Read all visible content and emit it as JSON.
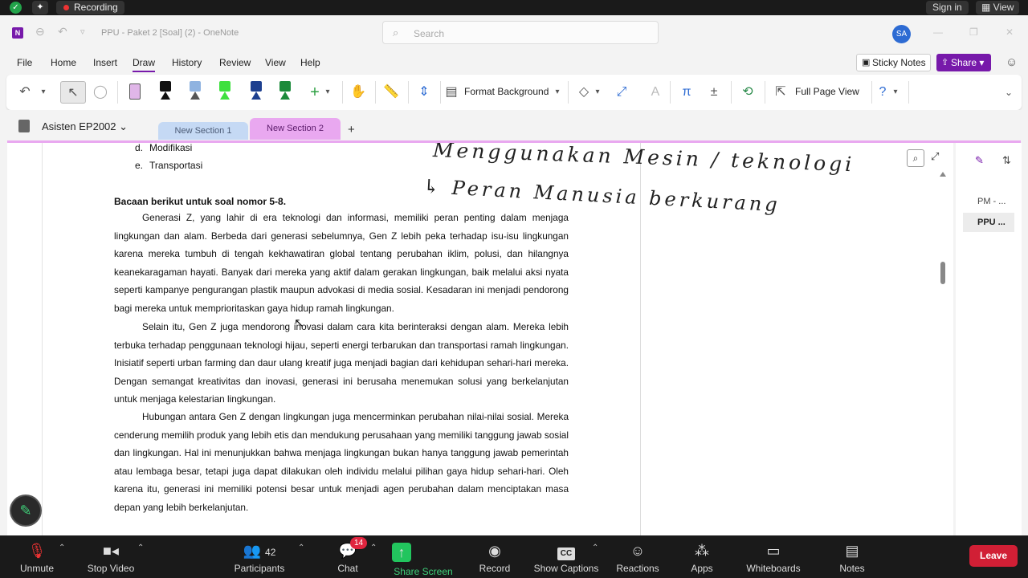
{
  "zoom_top": {
    "recording_label": "Recording",
    "signin_label": "Sign in",
    "view_label": "View"
  },
  "titlebar": {
    "title": "PPU - Paket 2 [Soal] (2)  -  OneNote",
    "search_placeholder": "Search",
    "avatar_initials": "SA"
  },
  "menu": {
    "file": "File",
    "home": "Home",
    "insert": "Insert",
    "draw": "Draw",
    "history": "History",
    "review": "Review",
    "view": "View",
    "help": "Help",
    "sticky_notes": "Sticky Notes",
    "share": "Share"
  },
  "ribbon": {
    "format_background": "Format Background",
    "full_page_view": "Full Page View"
  },
  "notebook": {
    "name": "Asisten EP2002",
    "sections": [
      "New Section 1",
      "New Section 2"
    ]
  },
  "page": {
    "list_items": [
      {
        "marker": "d.",
        "text": "Modifikasi"
      },
      {
        "marker": "e.",
        "text": "Transportasi"
      }
    ],
    "heading": "Bacaan berikut untuk soal nomor 5-8.",
    "paragraphs": [
      "Generasi Z, yang lahir di era teknologi dan informasi, memiliki peran penting dalam menjaga lingkungan dan alam. Berbeda dari generasi sebelumnya, Gen Z lebih peka terhadap isu-isu lingkungan karena mereka tumbuh di tengah kekhawatiran global tentang perubahan iklim, polusi, dan hilangnya keanekaragaman hayati. Banyak dari mereka yang aktif dalam gerakan lingkungan, baik melalui aksi nyata seperti kampanye pengurangan plastik maupun advokasi di media sosial. Kesadaran ini menjadi pendorong bagi mereka untuk memprioritaskan gaya hidup ramah lingkungan.",
      "Selain itu, Gen Z juga mendorong inovasi dalam cara kita berinteraksi dengan alam. Mereka lebih terbuka terhadap penggunaan teknologi hijau, seperti energi terbarukan dan transportasi ramah lingkungan. Inisiatif seperti urban farming dan daur ulang kreatif juga menjadi bagian dari kehidupan sehari-hari mereka. Dengan semangat kreativitas dan inovasi, generasi ini berusaha menemukan solusi yang berkelanjutan untuk menjaga kelestarian lingkungan.",
      "Hubungan antara Gen Z dengan lingkungan juga mencerminkan perubahan nilai-nilai sosial. Mereka cenderung memilih produk yang lebih etis dan mendukung perusahaan yang memiliki tanggung jawab sosial dan lingkungan. Hal ini menunjukkan bahwa menjaga lingkungan bukan hanya tanggung jawab pemerintah atau lembaga besar, tetapi juga dapat dilakukan oleh individu melalui pilihan gaya hidup sehari-hari. Oleh karena itu, generasi ini memiliki potensi besar untuk menjadi agen perubahan dalam menciptakan masa depan yang lebih berkelanjutan."
    ],
    "handwriting": [
      "Menggunakan Mesin / teknologi",
      "↳ Peran Manusia berkurang"
    ]
  },
  "pagelist": {
    "items": [
      "PM - ...",
      "PPU ..."
    ]
  },
  "zoom_bottom": {
    "unmute": "Unmute",
    "stop_video": "Stop Video",
    "participants_count": "42",
    "participants": "Participants",
    "chat_badge": "14",
    "chat": "Chat",
    "share_screen": "Share Screen",
    "record": "Record",
    "show_captions": "Show Captions",
    "cc_icon_text": "CC",
    "reactions": "Reactions",
    "apps": "Apps",
    "whiteboards": "Whiteboards",
    "notes": "Notes",
    "leave": "Leave"
  }
}
